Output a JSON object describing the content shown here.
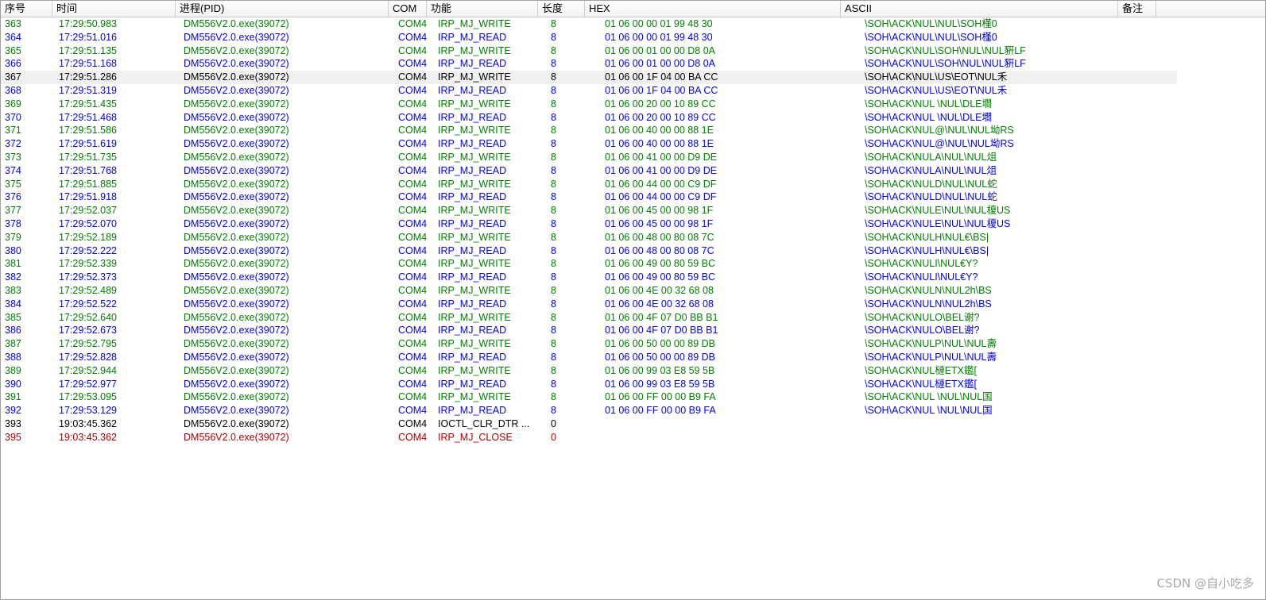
{
  "columns": {
    "seq": "序号",
    "time": "时间",
    "process": "进程(PID)",
    "com": "COM",
    "function": "功能",
    "length": "长度",
    "hex": "HEX",
    "ascii": "ASCII",
    "note": "备注"
  },
  "rows": [
    {
      "seq": "363",
      "time": "17:29:50.983",
      "process": "DM556V2.0.exe(39072)",
      "com": "COM4",
      "func": "IRP_MJ_WRITE",
      "len": "8",
      "hex": "01 06 00 00 01 99 48 30",
      "ascii": "\\SOH\\ACK\\NUL\\NUL\\SOH槿0",
      "kind": "write"
    },
    {
      "seq": "364",
      "time": "17:29:51.016",
      "process": "DM556V2.0.exe(39072)",
      "com": "COM4",
      "func": "IRP_MJ_READ",
      "len": "8",
      "hex": "01 06 00 00 01 99 48 30",
      "ascii": "\\SOH\\ACK\\NUL\\NUL\\SOH槿0",
      "kind": "read"
    },
    {
      "seq": "365",
      "time": "17:29:51.135",
      "process": "DM556V2.0.exe(39072)",
      "com": "COM4",
      "func": "IRP_MJ_WRITE",
      "len": "8",
      "hex": "01 06 00 01 00 00 D8 0A",
      "ascii": "\\SOH\\ACK\\NUL\\SOH\\NUL\\NUL豣LF",
      "kind": "write"
    },
    {
      "seq": "366",
      "time": "17:29:51.168",
      "process": "DM556V2.0.exe(39072)",
      "com": "COM4",
      "func": "IRP_MJ_READ",
      "len": "8",
      "hex": "01 06 00 01 00 00 D8 0A",
      "ascii": "\\SOH\\ACK\\NUL\\SOH\\NUL\\NUL豣LF",
      "kind": "read"
    },
    {
      "seq": "367",
      "time": "17:29:51.286",
      "process": "DM556V2.0.exe(39072)",
      "com": "COM4",
      "func": "IRP_MJ_WRITE",
      "len": "8",
      "hex": "01 06 00 1F 04 00 BA CC",
      "ascii": "\\SOH\\ACK\\NUL\\US\\EOT\\NUL禾",
      "kind": "write",
      "selected": true
    },
    {
      "seq": "368",
      "time": "17:29:51.319",
      "process": "DM556V2.0.exe(39072)",
      "com": "COM4",
      "func": "IRP_MJ_READ",
      "len": "8",
      "hex": "01 06 00 1F 04 00 BA CC",
      "ascii": "\\SOH\\ACK\\NUL\\US\\EOT\\NUL禾",
      "kind": "read"
    },
    {
      "seq": "369",
      "time": "17:29:51.435",
      "process": "DM556V2.0.exe(39072)",
      "com": "COM4",
      "func": "IRP_MJ_WRITE",
      "len": "8",
      "hex": "01 06 00 20 00 10 89 CC",
      "ascii": "\\SOH\\ACK\\NUL \\NUL\\DLE壛",
      "kind": "write"
    },
    {
      "seq": "370",
      "time": "17:29:51.468",
      "process": "DM556V2.0.exe(39072)",
      "com": "COM4",
      "func": "IRP_MJ_READ",
      "len": "8",
      "hex": "01 06 00 20 00 10 89 CC",
      "ascii": "\\SOH\\ACK\\NUL \\NUL\\DLE壛",
      "kind": "read"
    },
    {
      "seq": "371",
      "time": "17:29:51.586",
      "process": "DM556V2.0.exe(39072)",
      "com": "COM4",
      "func": "IRP_MJ_WRITE",
      "len": "8",
      "hex": "01 06 00 40 00 00 88 1E",
      "ascii": "\\SOH\\ACK\\NUL@\\NUL\\NUL坳RS",
      "kind": "write"
    },
    {
      "seq": "372",
      "time": "17:29:51.619",
      "process": "DM556V2.0.exe(39072)",
      "com": "COM4",
      "func": "IRP_MJ_READ",
      "len": "8",
      "hex": "01 06 00 40 00 00 88 1E",
      "ascii": "\\SOH\\ACK\\NUL@\\NUL\\NUL坳RS",
      "kind": "read"
    },
    {
      "seq": "373",
      "time": "17:29:51.735",
      "process": "DM556V2.0.exe(39072)",
      "com": "COM4",
      "func": "IRP_MJ_WRITE",
      "len": "8",
      "hex": "01 06 00 41 00 00 D9 DE",
      "ascii": "\\SOH\\ACK\\NULA\\NUL\\NUL俎",
      "kind": "write"
    },
    {
      "seq": "374",
      "time": "17:29:51.768",
      "process": "DM556V2.0.exe(39072)",
      "com": "COM4",
      "func": "IRP_MJ_READ",
      "len": "8",
      "hex": "01 06 00 41 00 00 D9 DE",
      "ascii": "\\SOH\\ACK\\NULA\\NUL\\NUL俎",
      "kind": "read"
    },
    {
      "seq": "375",
      "time": "17:29:51.885",
      "process": "DM556V2.0.exe(39072)",
      "com": "COM4",
      "func": "IRP_MJ_WRITE",
      "len": "8",
      "hex": "01 06 00 44 00 00 C9 DF",
      "ascii": "\\SOH\\ACK\\NULD\\NUL\\NUL蛇",
      "kind": "write"
    },
    {
      "seq": "376",
      "time": "17:29:51.918",
      "process": "DM556V2.0.exe(39072)",
      "com": "COM4",
      "func": "IRP_MJ_READ",
      "len": "8",
      "hex": "01 06 00 44 00 00 C9 DF",
      "ascii": "\\SOH\\ACK\\NULD\\NUL\\NUL蛇",
      "kind": "read"
    },
    {
      "seq": "377",
      "time": "17:29:52.037",
      "process": "DM556V2.0.exe(39072)",
      "com": "COM4",
      "func": "IRP_MJ_WRITE",
      "len": "8",
      "hex": "01 06 00 45 00 00 98 1F",
      "ascii": "\\SOH\\ACK\\NULE\\NUL\\NUL榎US",
      "kind": "write"
    },
    {
      "seq": "378",
      "time": "17:29:52.070",
      "process": "DM556V2.0.exe(39072)",
      "com": "COM4",
      "func": "IRP_MJ_READ",
      "len": "8",
      "hex": "01 06 00 45 00 00 98 1F",
      "ascii": "\\SOH\\ACK\\NULE\\NUL\\NUL榎US",
      "kind": "read"
    },
    {
      "seq": "379",
      "time": "17:29:52.189",
      "process": "DM556V2.0.exe(39072)",
      "com": "COM4",
      "func": "IRP_MJ_WRITE",
      "len": "8",
      "hex": "01 06 00 48 00 80 08 7C",
      "ascii": "\\SOH\\ACK\\NULH\\NUL€\\BS|",
      "kind": "write"
    },
    {
      "seq": "380",
      "time": "17:29:52.222",
      "process": "DM556V2.0.exe(39072)",
      "com": "COM4",
      "func": "IRP_MJ_READ",
      "len": "8",
      "hex": "01 06 00 48 00 80 08 7C",
      "ascii": "\\SOH\\ACK\\NULH\\NUL€\\BS|",
      "kind": "read"
    },
    {
      "seq": "381",
      "time": "17:29:52.339",
      "process": "DM556V2.0.exe(39072)",
      "com": "COM4",
      "func": "IRP_MJ_WRITE",
      "len": "8",
      "hex": "01 06 00 49 00 80 59 BC",
      "ascii": "\\SOH\\ACK\\NULI\\NUL€Y?",
      "kind": "write"
    },
    {
      "seq": "382",
      "time": "17:29:52.373",
      "process": "DM556V2.0.exe(39072)",
      "com": "COM4",
      "func": "IRP_MJ_READ",
      "len": "8",
      "hex": "01 06 00 49 00 80 59 BC",
      "ascii": "\\SOH\\ACK\\NULI\\NUL€Y?",
      "kind": "read"
    },
    {
      "seq": "383",
      "time": "17:29:52.489",
      "process": "DM556V2.0.exe(39072)",
      "com": "COM4",
      "func": "IRP_MJ_WRITE",
      "len": "8",
      "hex": "01 06 00 4E 00 32 68 08",
      "ascii": "\\SOH\\ACK\\NULN\\NUL2h\\BS",
      "kind": "write"
    },
    {
      "seq": "384",
      "time": "17:29:52.522",
      "process": "DM556V2.0.exe(39072)",
      "com": "COM4",
      "func": "IRP_MJ_READ",
      "len": "8",
      "hex": "01 06 00 4E 00 32 68 08",
      "ascii": "\\SOH\\ACK\\NULN\\NUL2h\\BS",
      "kind": "read"
    },
    {
      "seq": "385",
      "time": "17:29:52.640",
      "process": "DM556V2.0.exe(39072)",
      "com": "COM4",
      "func": "IRP_MJ_WRITE",
      "len": "8",
      "hex": "01 06 00 4F 07 D0 BB B1",
      "ascii": "\\SOH\\ACK\\NULO\\BEL谢?",
      "kind": "write"
    },
    {
      "seq": "386",
      "time": "17:29:52.673",
      "process": "DM556V2.0.exe(39072)",
      "com": "COM4",
      "func": "IRP_MJ_READ",
      "len": "8",
      "hex": "01 06 00 4F 07 D0 BB B1",
      "ascii": "\\SOH\\ACK\\NULO\\BEL谢?",
      "kind": "read"
    },
    {
      "seq": "387",
      "time": "17:29:52.795",
      "process": "DM556V2.0.exe(39072)",
      "com": "COM4",
      "func": "IRP_MJ_WRITE",
      "len": "8",
      "hex": "01 06 00 50 00 00 89 DB",
      "ascii": "\\SOH\\ACK\\NULP\\NUL\\NUL壽",
      "kind": "write"
    },
    {
      "seq": "388",
      "time": "17:29:52.828",
      "process": "DM556V2.0.exe(39072)",
      "com": "COM4",
      "func": "IRP_MJ_READ",
      "len": "8",
      "hex": "01 06 00 50 00 00 89 DB",
      "ascii": "\\SOH\\ACK\\NULP\\NUL\\NUL壽",
      "kind": "read"
    },
    {
      "seq": "389",
      "time": "17:29:52.944",
      "process": "DM556V2.0.exe(39072)",
      "com": "COM4",
      "func": "IRP_MJ_WRITE",
      "len": "8",
      "hex": "01 06 00 99 03 E8 59 5B",
      "ascii": "\\SOH\\ACK\\NUL槤ETX鑑[",
      "kind": "write"
    },
    {
      "seq": "390",
      "time": "17:29:52.977",
      "process": "DM556V2.0.exe(39072)",
      "com": "COM4",
      "func": "IRP_MJ_READ",
      "len": "8",
      "hex": "01 06 00 99 03 E8 59 5B",
      "ascii": "\\SOH\\ACK\\NUL槤ETX鑑[",
      "kind": "read"
    },
    {
      "seq": "391",
      "time": "17:29:53.095",
      "process": "DM556V2.0.exe(39072)",
      "com": "COM4",
      "func": "IRP_MJ_WRITE",
      "len": "8",
      "hex": "01 06 00 FF 00 00 B9 FA",
      "ascii": "\\SOH\\ACK\\NUL    \\NUL\\NUL国",
      "kind": "write"
    },
    {
      "seq": "392",
      "time": "17:29:53.129",
      "process": "DM556V2.0.exe(39072)",
      "com": "COM4",
      "func": "IRP_MJ_READ",
      "len": "8",
      "hex": "01 06 00 FF 00 00 B9 FA",
      "ascii": "\\SOH\\ACK\\NUL    \\NUL\\NUL国",
      "kind": "read"
    },
    {
      "seq": "393",
      "time": "19:03:45.362",
      "process": "DM556V2.0.exe(39072)",
      "com": "COM4",
      "func": "IOCTL_CLR_DTR    ...",
      "len": "0",
      "hex": "",
      "ascii": "",
      "kind": "ioctl"
    },
    {
      "seq": "395",
      "time": "19:03:45.362",
      "process": "DM556V2.0.exe(39072)",
      "com": "COM4",
      "func": "IRP_MJ_CLOSE",
      "len": "0",
      "hex": "",
      "ascii": "",
      "kind": "close"
    }
  ],
  "watermark": "CSDN @自小吃多",
  "colors": {
    "write": "#008000",
    "read": "#0000ff",
    "ioctl": "#000000",
    "close": "#b00000",
    "selected_bg": "#f0f0f0"
  }
}
